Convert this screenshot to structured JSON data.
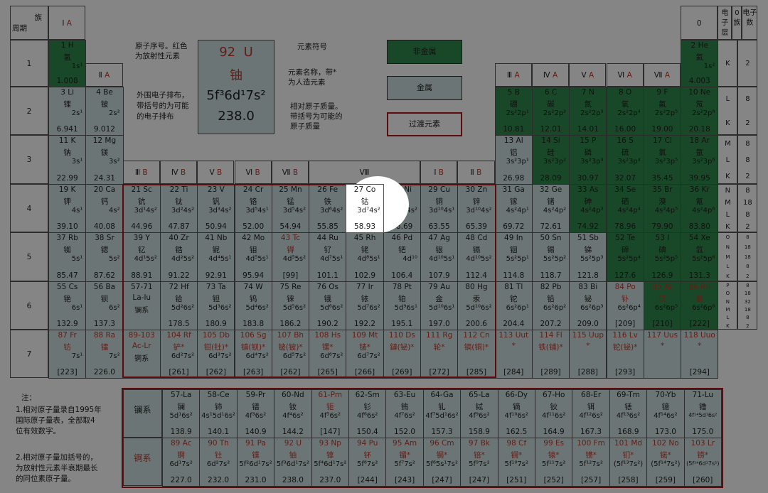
{
  "title": {
    "group_label": "族",
    "period_label": "周期"
  },
  "group_headers": [
    {
      "t": "Ⅰ A",
      "c": 0
    },
    {
      "t": "Ⅱ A",
      "c": 1
    },
    {
      "t": "Ⅲ B",
      "c": 2
    },
    {
      "t": "Ⅳ B",
      "c": 3
    },
    {
      "t": "Ⅴ B",
      "c": 4
    },
    {
      "t": "Ⅵ B",
      "c": 5
    },
    {
      "t": "Ⅶ B",
      "c": 6
    },
    {
      "t": "Ⅷ",
      "c": 7
    },
    {
      "t": "Ⅰ B",
      "c": 10
    },
    {
      "t": "Ⅱ B",
      "c": 11
    },
    {
      "t": "Ⅲ A",
      "c": 12
    },
    {
      "t": "Ⅳ A",
      "c": 13
    },
    {
      "t": "Ⅴ A",
      "c": 14
    },
    {
      "t": "Ⅵ A",
      "c": 15
    },
    {
      "t": "Ⅶ A",
      "c": 16
    },
    {
      "t": "0",
      "c": 17
    }
  ],
  "right_headers": {
    "layer": "电子层",
    "group0": "0族",
    "count": "电子数"
  },
  "periods": [
    "1",
    "2",
    "3",
    "4",
    "5",
    "6",
    "7"
  ],
  "shells": [
    [
      "K",
      "2"
    ],
    [
      "L\nK",
      "8\n2"
    ],
    [
      "M\nL\nK",
      "8\n8\n2"
    ],
    [
      "N\nM\nL\nK",
      "8\n18\n8\n2"
    ],
    [
      "O\nN\nM\nL\nK",
      "8\n18\n18\n8\n2"
    ],
    [
      "P\nO\nN\nM\nL\nK",
      "8\n18\n32\n18\n8\n2"
    ]
  ],
  "legend": {
    "demo": {
      "z": "92",
      "sym": "U",
      "name": "铀",
      "conf": "5f³6d¹7s²",
      "mass": "238.0"
    },
    "label_z": "原子序号。红色为放射性元素",
    "label_sym": "元素符号",
    "label_name": "元素名称，带*为人造元素",
    "label_conf": "外围电子排布，带括号的为可能的电子排布",
    "label_mass": "相对原子质量。带括号为可能的原子质量",
    "nonmetal": "非金属",
    "metal": "金属",
    "transition": "过渡元素"
  },
  "elements": [
    [
      "1",
      "H",
      "氢",
      "1s¹",
      "1.008",
      0,
      0,
      "n",
      0
    ],
    [
      "2",
      "He",
      "氦",
      "1s²",
      "4.003",
      0,
      17,
      "n",
      0
    ],
    [
      "3",
      "Li",
      "锂",
      "2s¹",
      "6.941",
      1,
      0,
      "m",
      0
    ],
    [
      "4",
      "Be",
      "铍",
      "2s²",
      "9.012",
      1,
      1,
      "m",
      0
    ],
    [
      "5",
      "B",
      "硼",
      "2s²2p¹",
      "10.81",
      1,
      12,
      "n",
      0
    ],
    [
      "6",
      "C",
      "碳",
      "2s²2p²",
      "12.01",
      1,
      13,
      "n",
      0
    ],
    [
      "7",
      "N",
      "氮",
      "2s²2p³",
      "14.01",
      1,
      14,
      "n",
      0
    ],
    [
      "8",
      "O",
      "氧",
      "2s²2p⁴",
      "16.00",
      1,
      15,
      "n",
      0
    ],
    [
      "9",
      "F",
      "氟",
      "2s²2p⁵",
      "19.00",
      1,
      16,
      "n",
      0
    ],
    [
      "10",
      "Ne",
      "氖",
      "2s²2p⁶",
      "20.18",
      1,
      17,
      "n",
      0
    ],
    [
      "11",
      "K",
      "钠",
      "3s¹",
      "22.99",
      2,
      0,
      "m",
      0
    ],
    [
      "12",
      "Mg",
      "镁",
      "3s²",
      "24.31",
      2,
      1,
      "m",
      0
    ],
    [
      "13",
      "Al",
      "铝",
      "3s²3p¹",
      "26.98",
      2,
      12,
      "m",
      0
    ],
    [
      "14",
      "Si",
      "硅",
      "3s²3p²",
      "28.09",
      2,
      13,
      "n",
      0
    ],
    [
      "15",
      "P",
      "磷",
      "3s²3p³",
      "30.97",
      2,
      14,
      "n",
      0
    ],
    [
      "16",
      "S",
      "硫",
      "3s²3p⁴",
      "32.07",
      2,
      15,
      "n",
      0
    ],
    [
      "17",
      "Cl",
      "氯",
      "3s²3p⁵",
      "35.45",
      2,
      16,
      "n",
      0
    ],
    [
      "18",
      "Ar",
      "氩",
      "3s²3p⁶",
      "39.95",
      2,
      17,
      "n",
      0
    ],
    [
      "19",
      "K",
      "钾",
      "4s¹",
      "39.10",
      3,
      0,
      "m",
      0
    ],
    [
      "20",
      "Ca",
      "钙",
      "4s²",
      "40.08",
      3,
      1,
      "m",
      0
    ],
    [
      "21",
      "Sc",
      "钪",
      "3d¹4s²",
      "44.96",
      3,
      2,
      "t",
      0
    ],
    [
      "22",
      "Ti",
      "钛",
      "3d²4s²",
      "47.87",
      3,
      3,
      "t",
      0
    ],
    [
      "23",
      "V",
      "钒",
      "3d³4s²",
      "50.94",
      3,
      4,
      "t",
      0
    ],
    [
      "24",
      "Cr",
      "铬",
      "3d⁵4s¹",
      "52.00",
      3,
      5,
      "t",
      0
    ],
    [
      "25",
      "Mn",
      "锰",
      "3d⁵4s²",
      "54.94",
      3,
      6,
      "t",
      0
    ],
    [
      "26",
      "Fe",
      "铁",
      "3d⁶4s²",
      "55.85",
      3,
      7,
      "t",
      0
    ],
    [
      "27",
      "Co",
      "钴",
      "3d⁷4s²",
      "58.93",
      3,
      8,
      "w",
      0
    ],
    [
      "28",
      "Ni",
      "镍",
      "3d⁸4s²",
      "58.69",
      3,
      9,
      "t",
      0
    ],
    [
      "29",
      "Cu",
      "铜",
      "3d¹⁰4s¹",
      "63.55",
      3,
      10,
      "t",
      0
    ],
    [
      "30",
      "Zn",
      "锌",
      "3d¹⁰4s²",
      "65.39",
      3,
      11,
      "t",
      0
    ],
    [
      "31",
      "Ga",
      "镓",
      "4s²4p¹",
      "69.72",
      3,
      12,
      "m",
      0
    ],
    [
      "32",
      "Ge",
      "锗",
      "4s²4p²",
      "72.61",
      3,
      13,
      "m",
      0
    ],
    [
      "33",
      "As",
      "砷",
      "4s²4p³",
      "74.92",
      3,
      14,
      "n",
      0
    ],
    [
      "34",
      "Se",
      "硒",
      "4s²4p⁴",
      "78.96",
      3,
      15,
      "n",
      0
    ],
    [
      "35",
      "Br",
      "溴",
      "4s²4p⁵",
      "79.90",
      3,
      16,
      "n",
      0
    ],
    [
      "36",
      "Kr",
      "氪",
      "4s²4p⁶",
      "83.80",
      3,
      17,
      "n",
      0
    ],
    [
      "37",
      "Rb",
      "铷",
      "5s¹",
      "85.47",
      4,
      0,
      "m",
      0
    ],
    [
      "38",
      "Sr",
      "锶",
      "5s²",
      "87.62",
      4,
      1,
      "m",
      0
    ],
    [
      "39",
      "Y",
      "钇",
      "4d¹5s²",
      "88.91",
      4,
      2,
      "t",
      0
    ],
    [
      "40",
      "Zr",
      "锆",
      "4d²5s²",
      "91.22",
      4,
      3,
      "t",
      0
    ],
    [
      "41",
      "Nb",
      "铌",
      "4d⁴5s¹",
      "92.91",
      4,
      4,
      "t",
      0
    ],
    [
      "42",
      "Mo",
      "钼",
      "4d⁵5s¹",
      "95.94",
      4,
      5,
      "t",
      0
    ],
    [
      "43",
      "Tc",
      "锝",
      "4d⁵5s²",
      "[99]",
      4,
      6,
      "t",
      1
    ],
    [
      "44",
      "Ru",
      "钌",
      "4d⁷5s¹",
      "101.1",
      4,
      7,
      "t",
      0
    ],
    [
      "45",
      "Rh",
      "铑",
      "4d⁸5s¹",
      "102.9",
      4,
      8,
      "t",
      0
    ],
    [
      "46",
      "Pd",
      "钯",
      "4d¹⁰",
      "106.4",
      4,
      9,
      "t",
      0
    ],
    [
      "47",
      "Ag",
      "银",
      "4d¹⁰5s¹",
      "107.9",
      4,
      10,
      "t",
      0
    ],
    [
      "48",
      "Cd",
      "镉",
      "4d¹⁰5s²",
      "112.4",
      4,
      11,
      "t",
      0
    ],
    [
      "49",
      "In",
      "铟",
      "5s²5p¹",
      "114.8",
      4,
      12,
      "m",
      0
    ],
    [
      "50",
      "Sn",
      "锡",
      "5s²5p²",
      "118.7",
      4,
      13,
      "m",
      0
    ],
    [
      "51",
      "Sb",
      "锑",
      "5s²5p³",
      "121.8",
      4,
      14,
      "m",
      0
    ],
    [
      "52",
      "Te",
      "碲",
      "5s²5p⁴",
      "127.6",
      4,
      15,
      "n",
      0
    ],
    [
      "53",
      "I",
      "碘",
      "5s²5p⁵",
      "126.9",
      4,
      16,
      "n",
      0
    ],
    [
      "54",
      "Xe",
      "氙",
      "5s²5p⁶",
      "131.3",
      4,
      17,
      "n",
      0
    ],
    [
      "55",
      "Cs",
      "铯",
      "6s¹",
      "132.9",
      5,
      0,
      "m",
      0
    ],
    [
      "56",
      "Ba",
      "钡",
      "6s²",
      "137.3",
      5,
      1,
      "m",
      0
    ],
    [
      "57-71",
      "",
      "La-lu",
      "镧系",
      "",
      5,
      2,
      "t",
      0
    ],
    [
      "72",
      "Hf",
      "铪",
      "5d²6s²",
      "178.5",
      5,
      3,
      "t",
      0
    ],
    [
      "73",
      "Ta",
      "钽",
      "5d³6s²",
      "180.9",
      5,
      4,
      "t",
      0
    ],
    [
      "74",
      "W",
      "钨",
      "5d⁴6s²",
      "183.8",
      5,
      5,
      "t",
      0
    ],
    [
      "75",
      "Re",
      "铼",
      "5d⁵6s²",
      "186.2",
      5,
      6,
      "t",
      0
    ],
    [
      "76",
      "Os",
      "锇",
      "5d⁶6s²",
      "190.2",
      5,
      7,
      "t",
      0
    ],
    [
      "77",
      "Ir",
      "铱",
      "5d⁷6s²",
      "192.2",
      5,
      8,
      "t",
      0
    ],
    [
      "78",
      "Pt",
      "铂",
      "5d⁹6s¹",
      "195.1",
      5,
      9,
      "t",
      0
    ],
    [
      "79",
      "Au",
      "金",
      "5d¹⁰6s¹",
      "197.0",
      5,
      10,
      "t",
      0
    ],
    [
      "80",
      "Hg",
      "汞",
      "5d¹⁰6s²",
      "200.6",
      5,
      11,
      "t",
      0
    ],
    [
      "81",
      "Tl",
      "铊",
      "6s²6p¹",
      "204.4",
      5,
      12,
      "m",
      0
    ],
    [
      "82",
      "Pb",
      "铅",
      "6s²6p²",
      "207.2",
      5,
      13,
      "m",
      0
    ],
    [
      "83",
      "Bi",
      "铋",
      "6s²6p³",
      "209.0",
      5,
      14,
      "m",
      0
    ],
    [
      "84",
      "Po",
      "钋",
      "6s²6p⁴",
      "[209]",
      5,
      15,
      "m",
      1
    ],
    [
      "85",
      "At",
      "砹",
      "6s²6p⁵",
      "[210]",
      5,
      16,
      "n",
      1
    ],
    [
      "86",
      "Rn",
      "氡",
      "6s²6p⁶",
      "[222]",
      5,
      17,
      "n",
      1
    ],
    [
      "87",
      "Fr",
      "钫",
      "7s¹",
      "[223]",
      6,
      0,
      "m",
      1
    ],
    [
      "88",
      "Ra",
      "镭",
      "7s²",
      "226.0",
      6,
      1,
      "m",
      1
    ],
    [
      "89-103",
      "",
      "Ac-Lr",
      "锕系",
      "",
      6,
      2,
      "t",
      1
    ],
    [
      "104",
      "Rf",
      "铲*",
      "6d²7s²",
      "[261]",
      6,
      3,
      "t",
      1
    ],
    [
      "105",
      "Db",
      "钳(钍)*",
      "6d³7s²",
      "[262]",
      6,
      4,
      "t",
      1
    ],
    [
      "106",
      "Sg",
      "镇(钡)*",
      "6d⁴7s²",
      "[263]",
      6,
      5,
      "t",
      1
    ],
    [
      "107",
      "Bh",
      "铍(铍)*",
      "6d⁵7s²",
      "[262]",
      6,
      6,
      "t",
      1
    ],
    [
      "108",
      "Hs",
      "镙*",
      "6d⁶7s²",
      "[265]",
      6,
      7,
      "t",
      1
    ],
    [
      "109",
      "Mt",
      "鿏*",
      "6d⁷7s²",
      "[266]",
      6,
      8,
      "t",
      1
    ],
    [
      "110",
      "Ds",
      "鐽(铋)*",
      "",
      "[269]",
      6,
      9,
      "t",
      1
    ],
    [
      "111",
      "Rg",
      "轮*",
      "",
      "[272]",
      6,
      10,
      "t",
      1
    ],
    [
      "112",
      "Cn",
      "镉(铜)*",
      "",
      "[285]",
      6,
      11,
      "t",
      1
    ],
    [
      "113",
      "Uut",
      "*",
      "",
      "[284]",
      6,
      12,
      "m",
      1
    ],
    [
      "114",
      "Fl",
      "铁(铺)*",
      "",
      "[289]",
      6,
      13,
      "m",
      1
    ],
    [
      "115",
      "Uup",
      "*",
      "",
      "[288]",
      6,
      14,
      "m",
      1
    ],
    [
      "116",
      "Lv",
      "铊(铋)*",
      "",
      "[293]",
      6,
      15,
      "m",
      1
    ],
    [
      "117",
      "Uus",
      "*",
      "",
      "",
      6,
      16,
      "m",
      1
    ],
    [
      "118",
      "Uuo",
      "*",
      "",
      "[294]",
      6,
      17,
      "m",
      1
    ]
  ],
  "lanthanides": {
    "label": "镧系",
    "items": [
      [
        "57-La",
        "镧",
        "5d¹6s²",
        "138.9",
        0
      ],
      [
        "58-Ce",
        "铈",
        "4s¹5d¹6s²",
        "140.1",
        0
      ],
      [
        "59-Pr",
        "镨",
        "4f³6s²",
        "140.9",
        0
      ],
      [
        "60-Nd",
        "钕",
        "4f⁴6s²",
        "144.2",
        0
      ],
      [
        "61-Pm",
        "钷",
        "4f⁵6s²",
        "[147]",
        1
      ],
      [
        "62-Sm",
        "钐",
        "4f⁶6s²",
        "150.4",
        0
      ],
      [
        "63-Eu",
        "铕",
        "4f⁷6s²",
        "152.0",
        0
      ],
      [
        "64-Ga",
        "钆",
        "4f⁷5d¹6s²",
        "157.3",
        0
      ],
      [
        "65-La",
        "铽",
        "4f⁹6s²",
        "158.9",
        0
      ],
      [
        "66-Dy",
        "镝",
        "4f¹⁰6s²",
        "162.5",
        0
      ],
      [
        "67-Ho",
        "钬",
        "4f¹¹6s²",
        "164.9",
        0
      ],
      [
        "68-Er",
        "铒",
        "4f¹²6s²",
        "167.3",
        0
      ],
      [
        "69-Tm",
        "铥",
        "4f¹³6s²",
        "168.9",
        0
      ],
      [
        "70-Yb",
        "镱",
        "4f¹⁴6s²",
        "173.0",
        0
      ],
      [
        "71-Lu",
        "镥",
        "4f¹⁴5d¹6s²",
        "175.0",
        0
      ]
    ]
  },
  "actinides": {
    "label": "锕系",
    "items": [
      [
        "89 Ac",
        "锕",
        "6d¹7s²",
        "227.0",
        1
      ],
      [
        "90 Th",
        "钍",
        "6d²7s²",
        "232.0",
        1
      ],
      [
        "91 Pa",
        "镤",
        "5f²6d¹7s²",
        "231.0",
        1
      ],
      [
        "92 U",
        "铀",
        "5f³6d¹7s²",
        "238.0",
        1
      ],
      [
        "93 Np",
        "镎",
        "5f⁴6d¹7s²",
        "237.0",
        1
      ],
      [
        "94 Pu",
        "钚",
        "5f⁶7s²",
        "[244]",
        1
      ],
      [
        "95 Am",
        "镅*",
        "5f⁷7s²",
        "[243]",
        1
      ],
      [
        "96 Cm",
        "锔*",
        "5f⁶5s¹7s²",
        "[247]",
        1
      ],
      [
        "97 Bk",
        "锫*",
        "5f⁹7s²",
        "[247]",
        1
      ],
      [
        "98 Cf",
        "锎*",
        "5f¹⁰7s²",
        "[251]",
        1
      ],
      [
        "99 Es",
        "锿*",
        "5f¹¹7s²",
        "[252]",
        1
      ],
      [
        "100 Fm",
        "镄*",
        "5f¹²7s²",
        "[257]",
        1
      ],
      [
        "101 Md",
        "钔*",
        "(5f¹³7s²)",
        "[258]",
        1
      ],
      [
        "102 No",
        "锘*",
        "(5f¹⁴7s²)",
        "[259]",
        1
      ],
      [
        "103 Lr",
        "铹*",
        "(5f¹⁴6d¹7s²)",
        "[260]",
        1
      ]
    ]
  },
  "notes": {
    "head": "注：",
    "n1": "1.相对原子量录自1995年国际原子量表，全部取4位有效数字。",
    "n2": "2.相对原子量加括号的，为放射性元素半衰期最长的同位素原子量。"
  }
}
